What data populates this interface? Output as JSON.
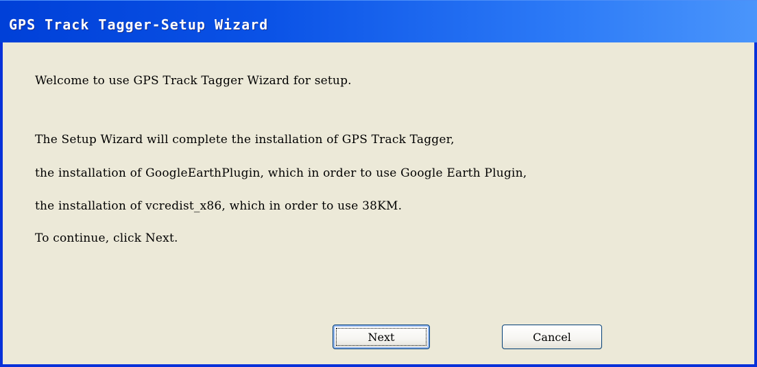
{
  "window": {
    "title": "GPS Track Tagger-Setup Wizard"
  },
  "content": {
    "welcome": "Welcome to use GPS Track Tagger Wizard for setup.",
    "line1": "The Setup Wizard will complete the installation of GPS Track Tagger,",
    "line2": "the installation of GoogleEarthPlugin, which in order to use Google Earth Plugin,",
    "line3": "the installation of vcredist_x86, which in order to use 38KM.",
    "line4": "To continue, click Next."
  },
  "buttons": {
    "next_label": "Next",
    "cancel_label": "Cancel"
  },
  "colors": {
    "titlebar": "#0a52e6",
    "window_bg": "#ece9d8",
    "button_border": "#003c74"
  }
}
